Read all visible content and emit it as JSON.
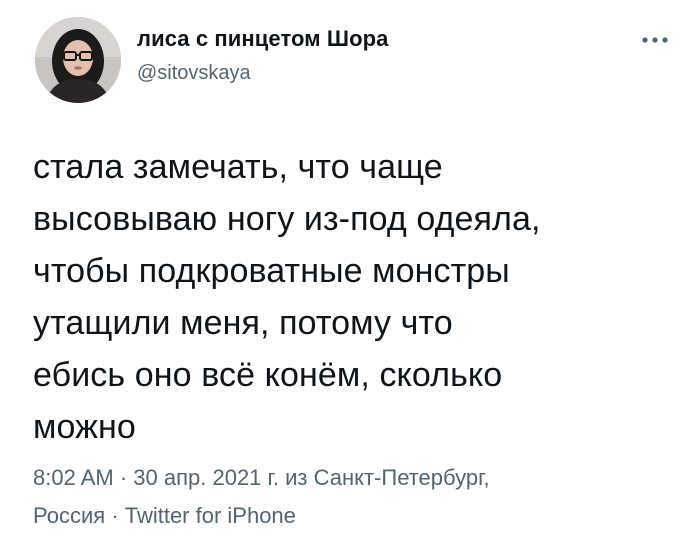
{
  "author": {
    "display_name": "лиса с пинцетом Шора",
    "handle": "@sitovskaya",
    "avatar_icon": "profile-photo"
  },
  "menu": {
    "icon": "more-horizontal-icon"
  },
  "tweet": {
    "lines": [
      "стала замечать, что чаще",
      "высовываю ногу из-под одеяла,",
      "чтобы подкроватные монстры",
      "утащили меня, потому что",
      "ебись оно всё конём, сколько",
      "можно"
    ]
  },
  "meta": {
    "time": "8:02 AM",
    "sep1": " · ",
    "date": "30 апр. 2021 г.",
    "from": " из ",
    "location_line1": "Санкт-Петербург,",
    "location_line2": "Россия",
    "sep2": " · ",
    "source": "Twitter for iPhone"
  },
  "colors": {
    "text": "#0f1419",
    "secondary": "#536471",
    "background": "#ffffff"
  }
}
